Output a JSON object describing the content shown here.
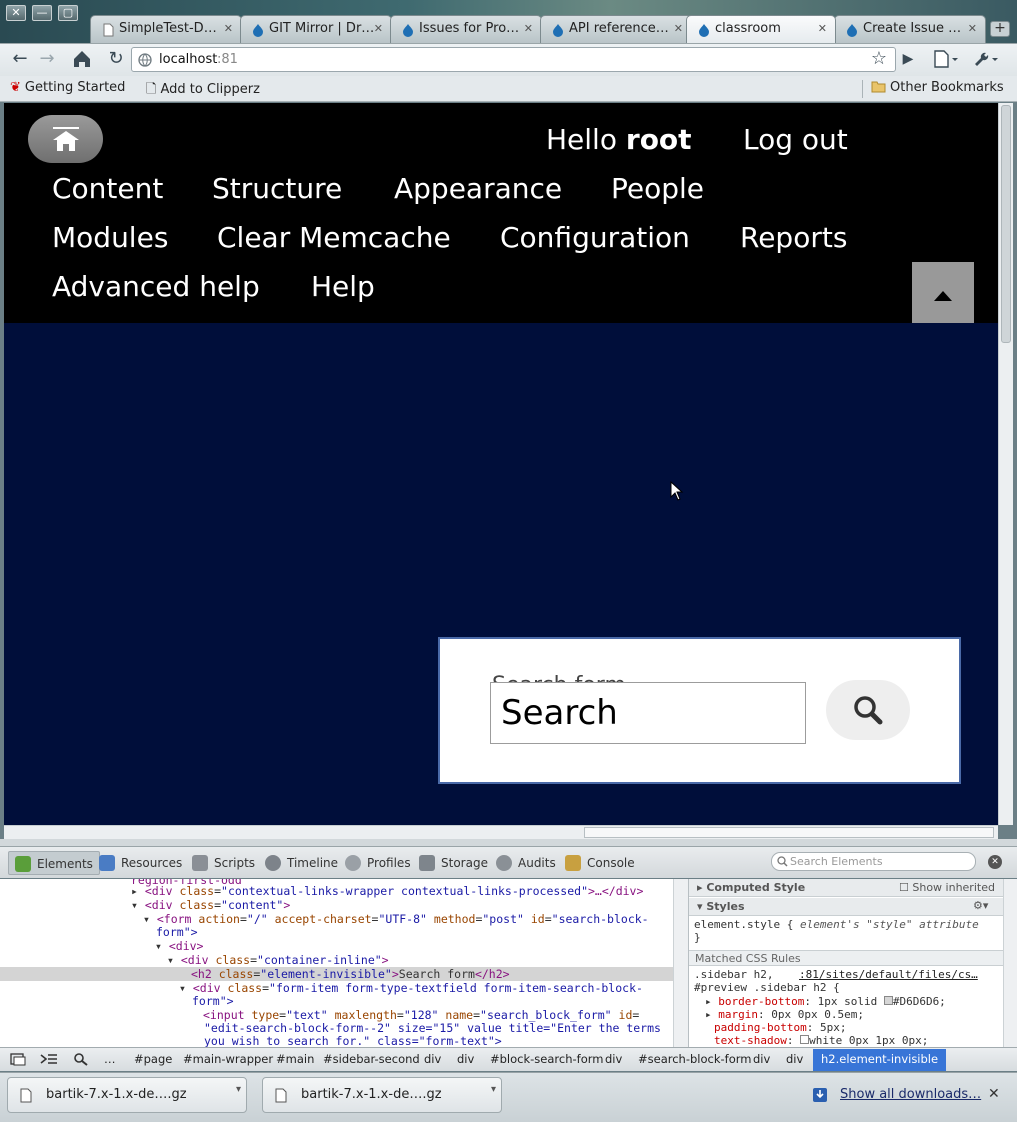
{
  "window": {
    "controls": [
      "✕",
      "—",
      "▢"
    ]
  },
  "tabs": [
    {
      "label": "SimpleTest-D…",
      "icon": "page-icon"
    },
    {
      "label": "GIT Mirror | Dr…",
      "icon": "drupal-icon"
    },
    {
      "label": "Issues for Pro…",
      "icon": "drupal-icon"
    },
    {
      "label": "API reference…",
      "icon": "drupal-icon"
    },
    {
      "label": "classroom",
      "icon": "drupal-icon",
      "active": true
    },
    {
      "label": "Create Issue …",
      "icon": "drupal-icon"
    }
  ],
  "toolbar": {
    "url_host": "localhost",
    "url_port": ":81"
  },
  "bookmarks": {
    "items": [
      "Getting Started",
      "Add to Clipperz"
    ],
    "other": "Other Bookmarks"
  },
  "page": {
    "greeting": "Hello",
    "user": "root",
    "logout": "Log out",
    "nav": [
      "Content",
      "Structure",
      "Appearance",
      "People",
      "Modules",
      "Clear Memcache",
      "Configuration",
      "Reports",
      "Advanced help",
      "Help"
    ],
    "search_value": "Search",
    "search_hidden_label": "Search form"
  },
  "devtools": {
    "tabs": [
      "Elements",
      "Resources",
      "Scripts",
      "Timeline",
      "Profiles",
      "Storage",
      "Audits",
      "Console"
    ],
    "search_placeholder": "Search Elements",
    "computed_style": "Computed Style",
    "show_inherited": "Show inherited",
    "styles": "Styles",
    "element_style": "element.style {",
    "element_style_note": "element's \"style\" attribute",
    "close_brace": "}",
    "matched_rules": "Matched CSS Rules",
    "rule_selector": ".sidebar h2,",
    "rule_selector2": "#preview .sidebar h2 {",
    "rule_source": ":81/sites/default/files/cs…",
    "props": [
      {
        "name": "border-bottom",
        "value": "1px solid",
        "swatch": "#D6D6D6",
        "swatch_label": "#D6D6D6;"
      },
      {
        "name": "margin",
        "value": "0px 0px 0.5em;"
      },
      {
        "name": "padding-bottom",
        "value": "5px;"
      },
      {
        "name": "text-shadow",
        "value": "white 0px 1px 0px;",
        "swatch": "#ffffff"
      }
    ],
    "dom": {
      "line0": "region-first-odd",
      "line1_tag": "<div ",
      "line1_attr": "class",
      "line1_val": "\"contextual-links-wrapper contextual-links-processed\"",
      "line1_end": ">…</div>",
      "line2_val": "\"content\"",
      "line3_action": "\"/\"",
      "line3_charset": "\"UTF-8\"",
      "line3_method": "\"post\"",
      "line3_id": "\"search-block-",
      "line3_cont": "form\">",
      "line4": "<div>",
      "line5_val": "\"container-inline\"",
      "line6_val": "\"element-invisible\"",
      "line6_text": "Search form",
      "line7_val": "\"form-item form-type-textfield form-item-search-block-",
      "line7_cont": "form\">",
      "line8_type": "\"text\"",
      "line8_max": "\"128\"",
      "line8_name": "\"search_block_form\"",
      "line9": "\"edit-search-block-form--2\" size=\"15\" value title=\"Enter the terms",
      "line10": "you wish to search for.\" class=\"form-text\">"
    },
    "breadcrumbs": [
      "#page",
      "#main-wrapper",
      "#main",
      "#sidebar-second",
      "div",
      "div",
      "#block-search-form",
      "div",
      "#search-block-form",
      "div",
      "div",
      "h2.element-invisible"
    ],
    "ellipsis": "…"
  },
  "downloads": {
    "items": [
      "bartik-7.x-1.x-de….gz",
      "bartik-7.x-1.x-de….gz"
    ],
    "show_all": "Show all downloads…"
  },
  "colors": {
    "page_bg": "#000e3a",
    "header_bg": "#000000",
    "selection": "#3875d7"
  }
}
